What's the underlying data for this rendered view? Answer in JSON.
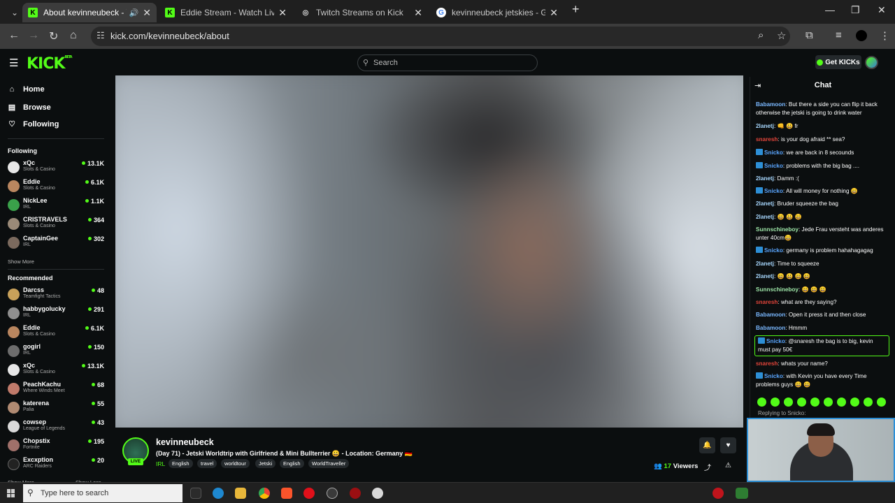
{
  "browser": {
    "tabs": [
      {
        "title": "About kevinneubeck - Watch Live",
        "favicon": "kick-icon",
        "active": true
      },
      {
        "title": "Eddie Stream - Watch Live on Kick",
        "favicon": "kick-icon",
        "active": false
      },
      {
        "title": "Twitch Streams on Kick",
        "favicon": "globe-icon",
        "active": false
      },
      {
        "title": "kevinneubeck jetskies - Google Search",
        "favicon": "google-icon",
        "active": false
      }
    ],
    "url": "kick.com/kevinneubeck/about"
  },
  "header": {
    "logo": "KICK",
    "logo_badge": "BETA",
    "search_placeholder": "Search",
    "get_kicks_label": "Get KICKs"
  },
  "sidebar": {
    "nav": [
      {
        "label": "Home",
        "icon": "home-icon"
      },
      {
        "label": "Browse",
        "icon": "browse-icon"
      },
      {
        "label": "Following",
        "icon": "heart-icon"
      }
    ],
    "following_title": "Following",
    "following": [
      {
        "name": "xQc",
        "category": "Slots & Casino",
        "viewers": "13.1K",
        "color": "#e7e7e7"
      },
      {
        "name": "Eddie",
        "category": "Slots & Casino",
        "viewers": "6.1K",
        "color": "#b9865f"
      },
      {
        "name": "NickLee",
        "category": "IRL",
        "viewers": "1.1K",
        "color": "#3aa14a"
      },
      {
        "name": "CRISTRAVELS",
        "category": "Slots & Casino",
        "viewers": "364",
        "color": "#9a8a78"
      },
      {
        "name": "CaptainGee",
        "category": "IRL",
        "viewers": "302",
        "color": "#7b6a5e"
      }
    ],
    "show_more": "Show More",
    "recommended_title": "Recommended",
    "recommended": [
      {
        "name": "Darcss",
        "category": "Teamfight Tactics",
        "viewers": "48",
        "color": "#c8a15a"
      },
      {
        "name": "habbygolucky",
        "category": "IRL",
        "viewers": "291",
        "color": "#8f8f8f"
      },
      {
        "name": "Eddie",
        "category": "Slots & Casino",
        "viewers": "6.1K",
        "color": "#b9865f"
      },
      {
        "name": "gogirl",
        "category": "IRL",
        "viewers": "150",
        "color": "#6d6d6d"
      },
      {
        "name": "xQc",
        "category": "Slots & Casino",
        "viewers": "13.1K",
        "color": "#e7e7e7"
      },
      {
        "name": "PeachKachu",
        "category": "Where Winds Meet",
        "viewers": "68",
        "color": "#c07a6a"
      },
      {
        "name": "katerena",
        "category": "Palia",
        "viewers": "55",
        "color": "#b08a72"
      },
      {
        "name": "cowsep",
        "category": "League of Legends",
        "viewers": "43",
        "color": "#d9d9d9"
      },
      {
        "name": "Chopstix",
        "category": "Fortnite",
        "viewers": "195",
        "color": "#a0706a"
      },
      {
        "name": "Excxption",
        "category": "ARC Raiders",
        "viewers": "20",
        "color": "#222222"
      }
    ],
    "show_more_2": "Show More",
    "show_less": "Show Less"
  },
  "stream": {
    "name": "kevinneubeck",
    "title": "(Day 71) - Jetski Worldtrip with Girlfriend & Mini Bullterrier 😀 - Location: Germany 🇩🇪",
    "category": "IRL",
    "tags": [
      "English",
      "travel",
      "worldtour",
      "Jetski",
      "English",
      "WorldTraveller"
    ],
    "live_label": "LIVE",
    "viewers_count": "17",
    "viewers_label": "Viewers"
  },
  "chat": {
    "title": "Chat",
    "messages": [
      {
        "user": "Babamoon",
        "color": "#7ab8ff",
        "badge": false,
        "text": ": But there a side you can flip it back otherwise the jetski is going to drink water"
      },
      {
        "user": "2lanetj",
        "color": "#a8d8ff",
        "badge": false,
        "text": ": 👊 😀 fr"
      },
      {
        "user": "snaresh",
        "color": "#e0443a",
        "badge": false,
        "text": ": is your dog afraid ** sea?"
      },
      {
        "user": "Snicko",
        "color": "#5aa6ff",
        "badge": true,
        "text": ": we are back in 8 secounds"
      },
      {
        "user": "Snicko",
        "color": "#5aa6ff",
        "badge": true,
        "text": ": problems with the big bag ...."
      },
      {
        "user": "2lanetj",
        "color": "#a8d8ff",
        "badge": false,
        "text": ": Damm :("
      },
      {
        "user": "Snicko",
        "color": "#5aa6ff",
        "badge": true,
        "text": ": All will money for nothing 😀"
      },
      {
        "user": "2lanetj",
        "color": "#a8d8ff",
        "badge": false,
        "text": ": Bruder squeeze the bag"
      },
      {
        "user": "2lanetj",
        "color": "#a8d8ff",
        "badge": false,
        "text": ": 😀 😀 😀"
      },
      {
        "user": "Sunnschineboy",
        "color": "#9ee6a8",
        "badge": false,
        "text": ": Jede Frau versteht was anderes unter 40cm😀"
      },
      {
        "user": "Snicko",
        "color": "#5aa6ff",
        "badge": true,
        "text": ": germany is problem hahahagagag"
      },
      {
        "user": "2lanetj",
        "color": "#a8d8ff",
        "badge": false,
        "text": ": Time to squeeze"
      },
      {
        "user": "2lanetj",
        "color": "#a8d8ff",
        "badge": false,
        "text": ": 😀 😀 😀 😀"
      },
      {
        "user": "Sunnschineboy",
        "color": "#9ee6a8",
        "badge": false,
        "text": ": 😀 😀 😀"
      },
      {
        "user": "snaresh",
        "color": "#e0443a",
        "badge": false,
        "text": ": what are they saying?"
      },
      {
        "user": "Babamoon",
        "color": "#7ab8ff",
        "badge": false,
        "text": ": Open it press it and then close"
      },
      {
        "user": "Babamoon",
        "color": "#7ab8ff",
        "badge": false,
        "text": ": Hmmm"
      },
      {
        "user": "Snicko",
        "color": "#5aa6ff",
        "badge": true,
        "text": ": @snaresh the bag is to big, kevin must pay 50€"
      },
      {
        "user": "snaresh",
        "color": "#e0443a",
        "badge": false,
        "text": ": whats your name?"
      },
      {
        "user": "Snicko",
        "color": "#5aa6ff",
        "badge": true,
        "text": ": with Kevin you have every Time problems guys 😀 😀"
      }
    ],
    "replying_to": "Replying to Snicko:"
  },
  "taskbar": {
    "search_placeholder": "Type here to search"
  }
}
